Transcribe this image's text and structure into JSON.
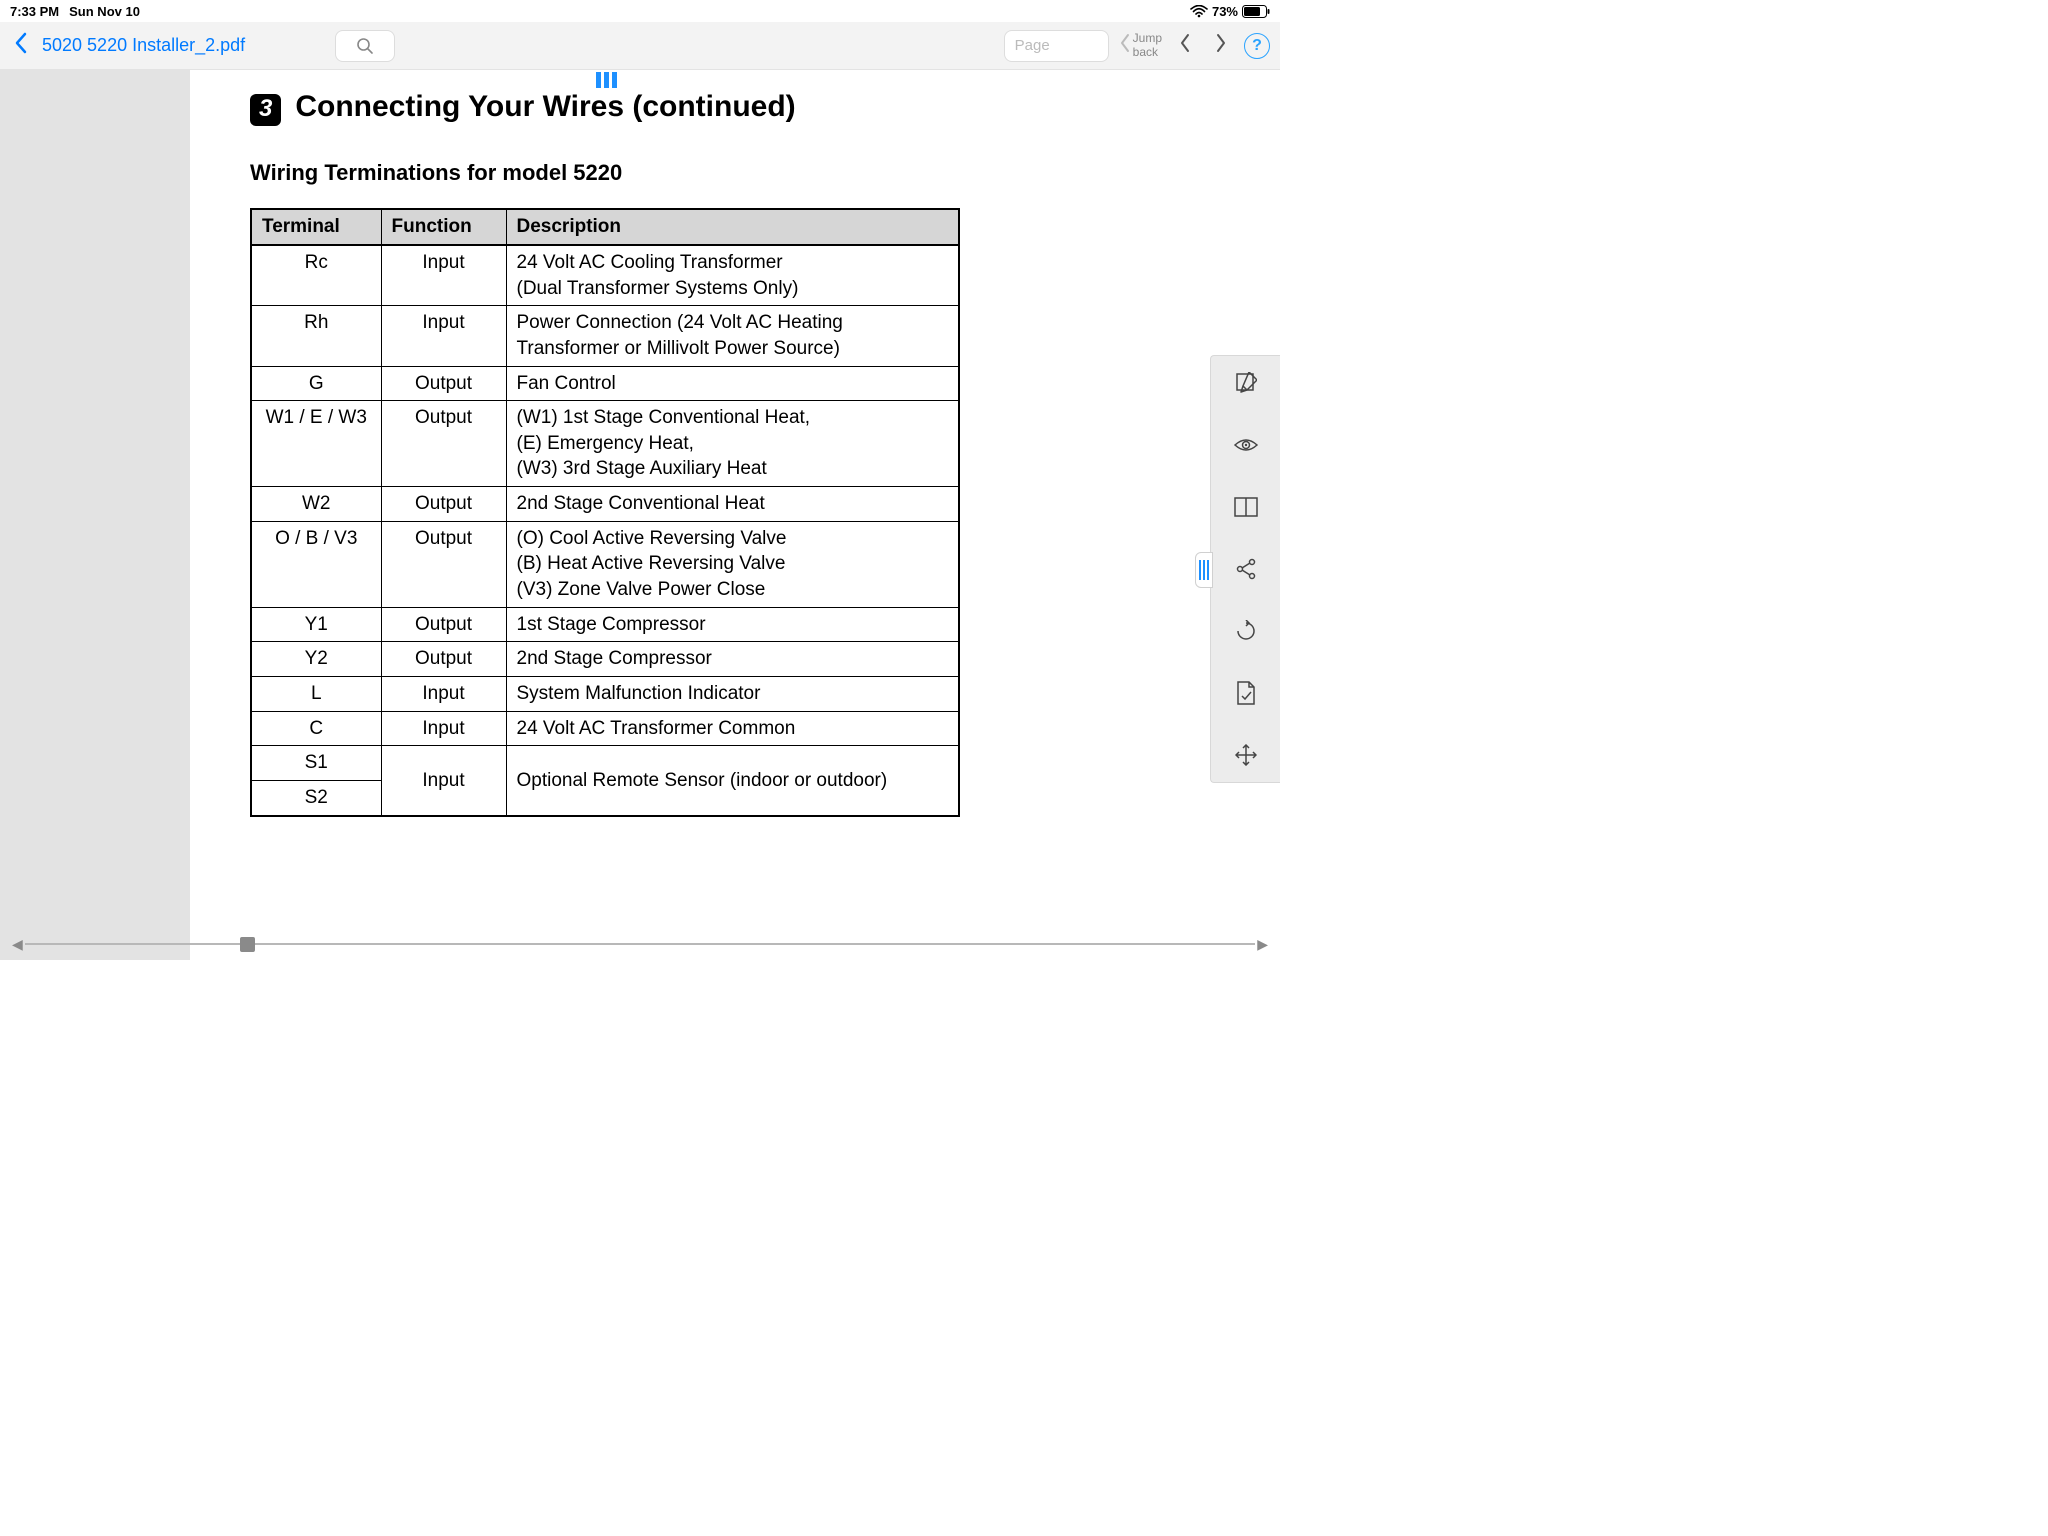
{
  "status": {
    "time": "7:33 PM",
    "date": "Sun Nov 10",
    "battery": "73%"
  },
  "toolbar": {
    "doc_title": "5020 5220 Installer_2.pdf",
    "page_placeholder": "Page",
    "jump_back": "Jump\nback",
    "help": "?"
  },
  "doc": {
    "step_num": "3",
    "section_title_a": "Connecting Your Wires ",
    "section_title_b": "(continued)",
    "subheading": "Wiring Terminations for model 5220",
    "headers": {
      "c1": "Terminal",
      "c2": "Function",
      "c3": "Description"
    },
    "rows": [
      {
        "t": "Rc",
        "f": "Input",
        "d": "24 Volt AC Cooling Transformer\n(Dual Transformer Systems Only)"
      },
      {
        "t": "Rh",
        "f": "Input",
        "d": "Power Connection (24 Volt AC Heating\nTransformer or Millivolt Power Source)"
      },
      {
        "t": "G",
        "f": "Output",
        "d": "Fan Control"
      },
      {
        "t": "W1 / E / W3",
        "f": "Output",
        "d": "(W1) 1st Stage Conventional Heat,\n(E) Emergency Heat,\n(W3) 3rd Stage Auxiliary Heat"
      },
      {
        "t": "W2",
        "f": "Output",
        "d": "2nd Stage Conventional Heat"
      },
      {
        "t": "O / B / V3",
        "f": "Output",
        "d": "(O) Cool Active Reversing Valve\n(B) Heat Active Reversing Valve\n(V3) Zone Valve Power Close"
      },
      {
        "t": "Y1",
        "f": "Output",
        "d": "1st Stage Compressor"
      },
      {
        "t": "Y2",
        "f": "Output",
        "d": "2nd Stage Compressor"
      },
      {
        "t": "L",
        "f": "Input",
        "d": "System Malfunction Indicator"
      },
      {
        "t": "C",
        "f": "Input",
        "d": "24 Volt AC Transformer Common"
      }
    ],
    "last_row": {
      "t1": "S1",
      "t2": "S2",
      "f": "Input",
      "d": "Optional Remote Sensor (indoor or outdoor)"
    }
  }
}
